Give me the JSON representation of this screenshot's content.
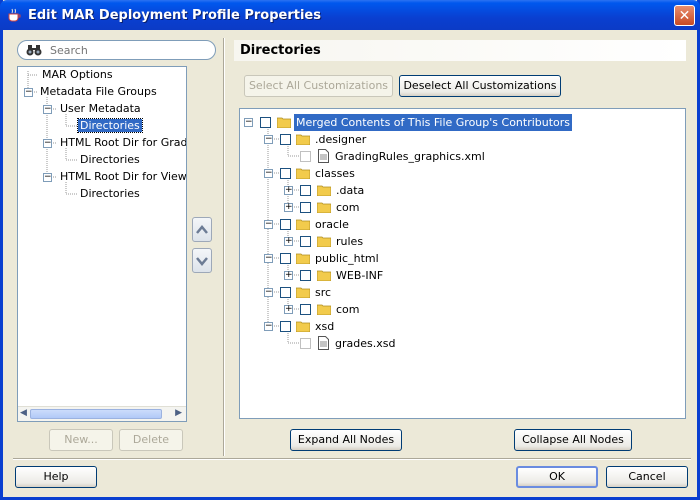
{
  "window": {
    "title": "Edit MAR Deployment Profile Properties",
    "close_label": "✕"
  },
  "search": {
    "placeholder": "Search"
  },
  "nav": {
    "items": [
      {
        "label": "MAR Options"
      },
      {
        "label": "Metadata File Groups"
      },
      {
        "label": "User Metadata"
      },
      {
        "label": "Directories"
      },
      {
        "label": "HTML Root Dir for Grades"
      },
      {
        "label": "Directories"
      },
      {
        "label": "HTML Root Dir for ViewCor"
      },
      {
        "label": "Directories"
      }
    ],
    "new_label": "New...",
    "delete_label": "Delete"
  },
  "section": {
    "title": "Directories"
  },
  "toolbar": {
    "select_all_label": "Select All Customizations",
    "deselect_all_label": "Deselect All Customizations"
  },
  "tree": {
    "root": "Merged Contents of This File Group's Contributors",
    "nodes": [
      {
        "label": ".designer"
      },
      {
        "label": "GradingRules_graphics.xml"
      },
      {
        "label": "classes"
      },
      {
        "label": ".data"
      },
      {
        "label": "com"
      },
      {
        "label": "oracle"
      },
      {
        "label": "rules"
      },
      {
        "label": "public_html"
      },
      {
        "label": "WEB-INF"
      },
      {
        "label": "src"
      },
      {
        "label": "com"
      },
      {
        "label": "xsd"
      },
      {
        "label": "grades.xsd"
      }
    ]
  },
  "actions": {
    "expand_label": "Expand All Nodes",
    "collapse_label": "Collapse All Nodes"
  },
  "footer": {
    "help_label": "Help",
    "ok_label": "OK",
    "cancel_label": "Cancel"
  },
  "colors": {
    "title_bar": "#0A3FD0",
    "selection": "#316AC5",
    "folder": "#F2CB4C",
    "dialog_bg": "#ECE9D8"
  }
}
